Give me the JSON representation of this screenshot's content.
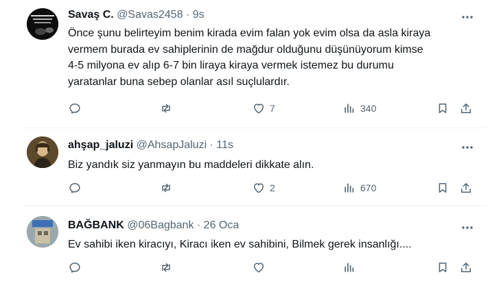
{
  "tweets": [
    {
      "name": "Savaş C.",
      "handle": "@Savas2458",
      "dot": "·",
      "time": "9s",
      "text_lines": [
        "Önce şunu belirteyim benim kirada evim falan yok evim olsa da asla kiraya",
        "vermem burada ev sahiplerinin de mağdur olduğunu düşünüyorum kimse",
        "4-5 milyona ev alıp 6-7 bin liraya kiraya vermek istemez bu durumu",
        "yaratanlar buna sebep olanlar asıl suçlulardır."
      ],
      "likes": "7",
      "views": "340"
    },
    {
      "name": "ahşap_jaluzi",
      "handle": "@AhsapJaluzi",
      "dot": "·",
      "time": "11s",
      "text_lines": [
        "Biz yandık siz yanmayın bu maddeleri dikkate alın."
      ],
      "likes": "2",
      "views": "670"
    },
    {
      "name": "BAĞBANK",
      "handle": "@06Bagbank",
      "dot": "·",
      "time": "26 Oca",
      "text_lines": [
        "Ev sahibi iken kiracıyı, Kiracı iken ev sahibini, Bilmek gerek insanlığı...."
      ]
    }
  ],
  "icons": {
    "more": "more-icon",
    "reply": "reply-icon",
    "retweet": "retweet-icon",
    "like": "like-icon",
    "views": "views-icon",
    "bookmark": "bookmark-icon",
    "share": "share-icon"
  },
  "colors": {
    "text": "#0f1419",
    "secondary": "#536471",
    "divider": "#eff3f4"
  }
}
